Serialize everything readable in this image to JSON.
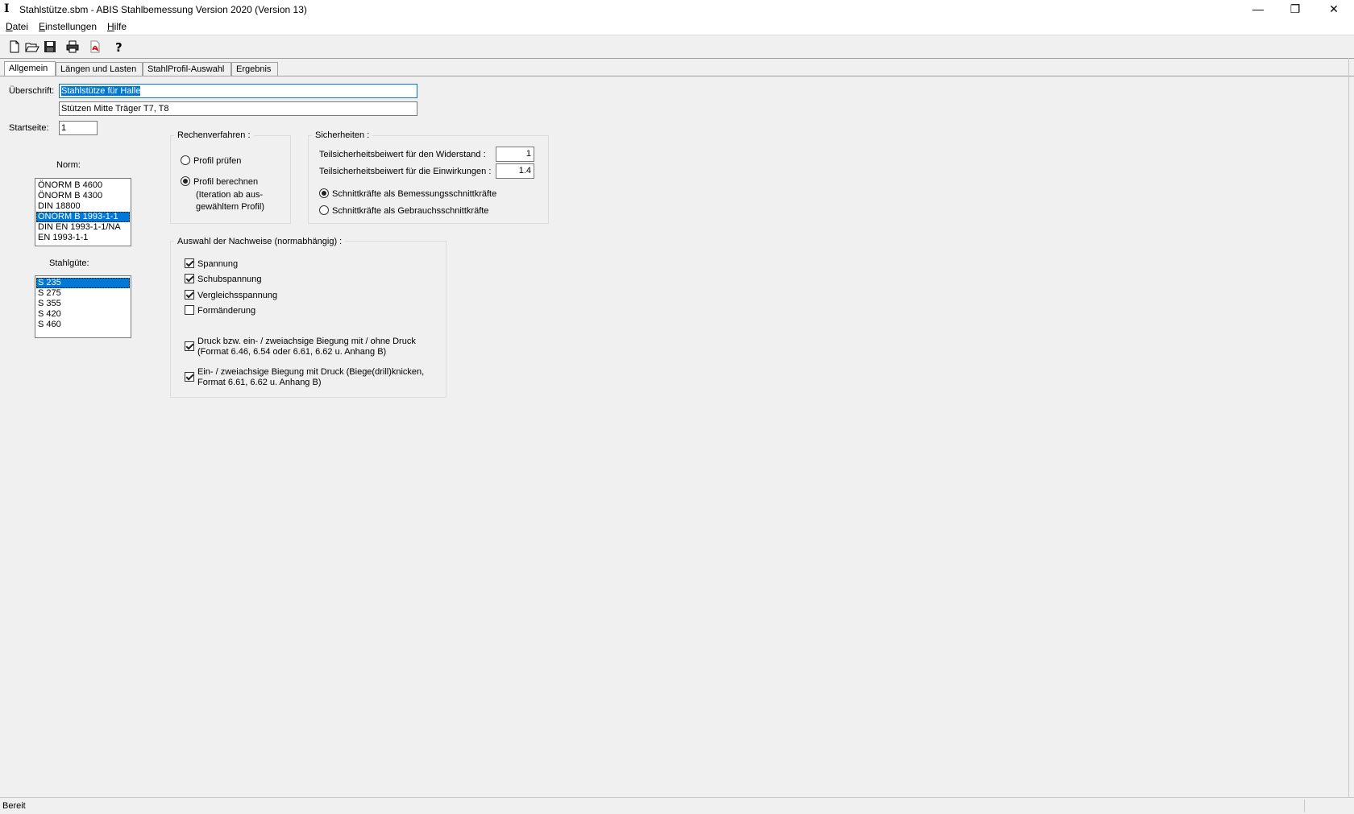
{
  "window": {
    "title": "Stahlstütze.sbm - ABIS Stahlbemessung Version 2020 (Version 13)",
    "app_icon": "I",
    "minimize": "—",
    "restore": "❐",
    "close": "✕"
  },
  "menu": {
    "items": [
      {
        "prefix": "",
        "key": "D",
        "rest": "atei"
      },
      {
        "prefix": "",
        "key": "E",
        "rest": "instellungen"
      },
      {
        "prefix": "",
        "key": "H",
        "rest": "ilfe"
      }
    ]
  },
  "toolbar": {
    "icons": [
      "new-file-icon",
      "open-folder-icon",
      "save-icon",
      "print-icon",
      "pdf-icon",
      "help-icon"
    ]
  },
  "tabs": [
    "Allgemein",
    "Längen und Lasten",
    "StahlProfil-Auswahl",
    "Ergebnis"
  ],
  "general": {
    "heading_label": "Überschrift:",
    "heading_line1": "Stahlstütze für Halle",
    "heading_line2": "Stützen Mitte Träger T7, T8",
    "start_page_label": "Startseite:",
    "start_page_value": "1",
    "norm_label": "Norm:",
    "norm_options": [
      "ÖNORM B 4600",
      "ÖNORM B 4300",
      "DIN 18800",
      "ÖNORM B 1993-1-1",
      "DIN EN 1993-1-1/NA",
      "EN 1993-1-1"
    ],
    "norm_selected": "ÖNORM B 1993-1-1",
    "steel_label": "Stahlgüte:",
    "steel_options": [
      "S 235",
      "S 275",
      "S 355",
      "S 420",
      "S 460"
    ],
    "steel_selected": "S 235"
  },
  "calc_method": {
    "title": "Rechenverfahren :",
    "option1": "Profil prüfen",
    "option2": "Profil berechnen",
    "option2_note1": "(Iteration ab aus-",
    "option2_note2": "gewähltem Profil)",
    "selected": "Profil berechnen"
  },
  "safety": {
    "title": "Sicherheiten :",
    "resistance_label": "Teilsicherheitsbeiwert für den Widerstand :",
    "resistance_value": "1",
    "actions_label": "Teilsicherheitsbeiwert für die Einwirkungen :",
    "actions_value": "1.4",
    "radio1": "Schnittkräfte als Bemessungsschnittkräfte",
    "radio2": "Schnittkräfte als Gebrauchsschnittkräfte",
    "selected": "Schnittkräfte als Bemessungsschnittkräfte"
  },
  "checks": {
    "title": "Auswahl der Nachweise  (normabhängig) :",
    "items": [
      {
        "label": "Spannung",
        "checked": true
      },
      {
        "label": "Schubspannung",
        "checked": true
      },
      {
        "label": "Vergleichsspannung",
        "checked": true
      },
      {
        "label": "Formänderung",
        "checked": false
      }
    ],
    "compression_line1": "Druck bzw. ein- / zweiachsige Biegung mit / ohne Druck",
    "compression_line2": "(Format 6.46, 6.54 oder 6.61, 6.62 u. Anhang B)",
    "compression_checked": true,
    "buckling_line1": "Ein- / zweiachsige Biegung mit Druck (Biege(drill)knicken,",
    "buckling_line2": "Format 6.61, 6.62 u. Anhang B)",
    "buckling_checked": true
  },
  "status": {
    "text": "Bereit"
  }
}
